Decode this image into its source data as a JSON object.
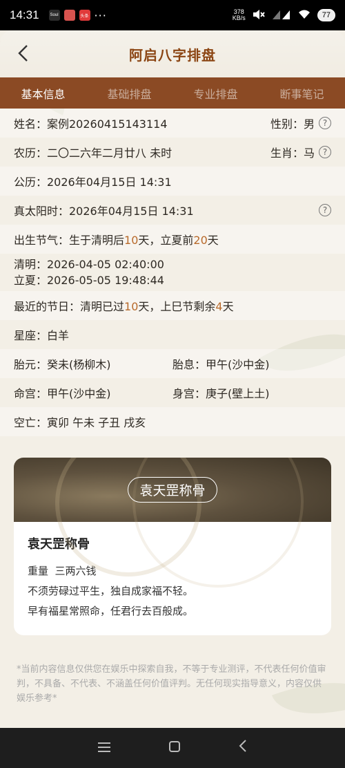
{
  "status_bar": {
    "time": "14:31",
    "apps": [
      {
        "icon": "soul-app-icon",
        "label": "Soul",
        "color": "#2c2c2c"
      },
      {
        "icon": "game-app-icon",
        "label": "",
        "color": "#d9534f"
      },
      {
        "icon": "toutiao-app-icon",
        "label": "头条",
        "color": "#e03a3a"
      }
    ],
    "more": "···",
    "speed": "378\nKB/s",
    "battery": "77"
  },
  "header": {
    "title": "阿启八字排盘"
  },
  "tabs": [
    "基本信息",
    "基础排盘",
    "专业排盘",
    "断事笔记"
  ],
  "info": {
    "name": "姓名：案例20260415143114",
    "gender": "性别：男",
    "lunar": "农历：二〇二六年二月廿八 未时",
    "zodiac": "生肖：马",
    "solar": "公历：2026年04月15日 14:31",
    "true_solar": "真太阳时：2026年04月15日 14:31",
    "solar_term_prefix": "出生节气：生于清明后",
    "solar_term_after_days": "10",
    "solar_term_mid": "天，立夏前",
    "solar_term_before_days": "20",
    "solar_term_suffix": "天",
    "qingming": "清明：2026-04-05 02:40:00",
    "lixia": "立夏：2026-05-05 19:48:44",
    "festival_prefix": "最近的节日：清明已过",
    "festival_passed_days": "10",
    "festival_mid": "天，上巳节剩余",
    "festival_remaining_days": "4",
    "festival_suffix": "天",
    "constellation": "星座：白羊",
    "taiyuan": "胎元：癸未(杨柳木)",
    "taixi": "胎息：甲午(沙中金)",
    "minggong": "命宫：甲午(沙中金)",
    "shengong": "身宫：庚子(壁上土)",
    "kongwang": "空亡：寅卯 午未 子丑 戌亥"
  },
  "card": {
    "banner_label": "袁天罡称骨",
    "title": "袁天罡称骨",
    "weight": "重量  三两六钱",
    "poem_line1": "不须劳碌过平生，独自成家福不轻。",
    "poem_line2": "早有福星常照命，任君行去百般成。"
  },
  "disclaimer": "*当前内容信息仅供您在娱乐中探索自我，不等于专业测评，不代表任何价值审判，不具备、不代表、不涵盖任何价值评判。无任何现实指导意义，内容仅供娱乐参考*",
  "colors": {
    "tab_bar": "#8b4a24",
    "title": "#8b4513",
    "highlight": "#b86a2b"
  }
}
